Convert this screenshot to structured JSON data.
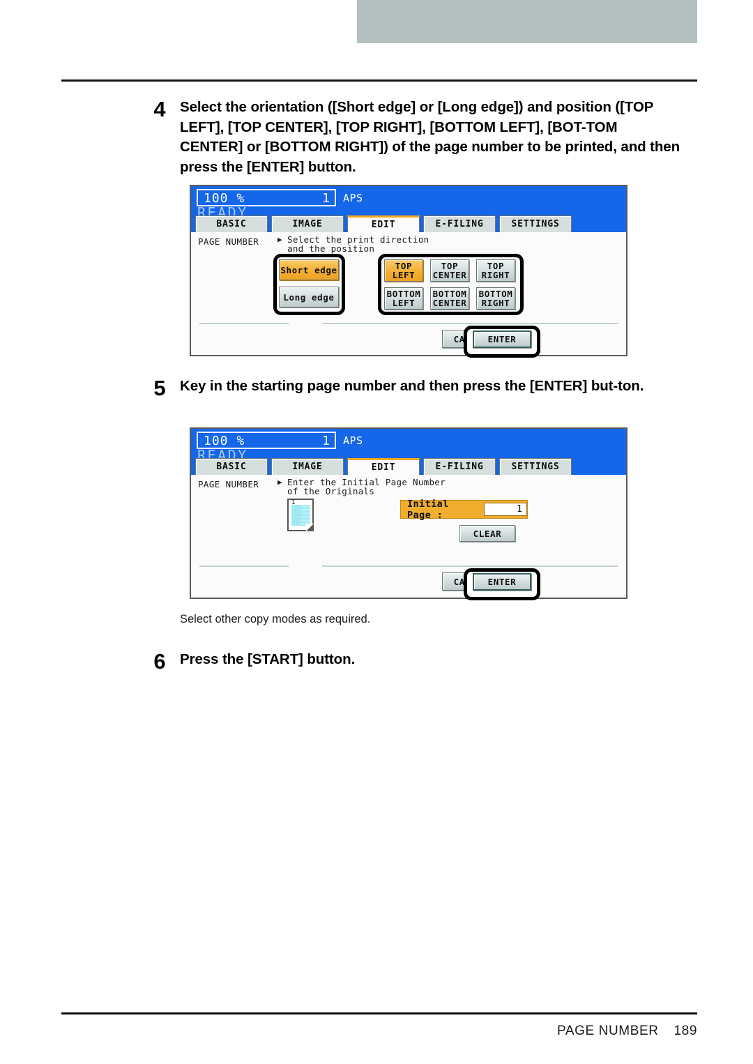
{
  "footer": {
    "label": "PAGE NUMBER",
    "page": "189"
  },
  "steps": [
    {
      "number": "4",
      "text": "Select the orientation ([Short edge] or [Long edge]) and position ([TOP LEFT], [TOP CENTER], [TOP RIGHT], [BOTTOM LEFT], [BOT-TOM CENTER] or [BOTTOM RIGHT]) of the page number to be printed, and then press the [ENTER] button."
    },
    {
      "number": "5",
      "text": "Key in the starting page number and then press the [ENTER] but-ton."
    },
    {
      "number": "6",
      "text": "Press the [START] button."
    }
  ],
  "note": "Select other copy modes as required.",
  "panel1": {
    "header": {
      "zoom": "100  %",
      "copies": "1",
      "paper_mode": "APS",
      "status": "READY"
    },
    "tabs": [
      {
        "label": "BASIC",
        "active": false
      },
      {
        "label": "IMAGE",
        "active": false
      },
      {
        "label": "EDIT",
        "active": true
      },
      {
        "label": "E-FILING",
        "active": false
      },
      {
        "label": "SETTINGS",
        "active": false
      }
    ],
    "function_label": "PAGE NUMBER",
    "instruction_line1": "Select the print direction",
    "instruction_line2": "and the position",
    "orientation_buttons": [
      {
        "label": "Short edge",
        "selected": true
      },
      {
        "label": "Long edge",
        "selected": false
      }
    ],
    "position_buttons": [
      {
        "line1": "TOP",
        "line2": "LEFT",
        "selected": true
      },
      {
        "line1": "TOP",
        "line2": "CENTER",
        "selected": false
      },
      {
        "line1": "TOP",
        "line2": "RIGHT",
        "selected": false
      },
      {
        "line1": "BOTTOM",
        "line2": "LEFT",
        "selected": false
      },
      {
        "line1": "BOTTOM",
        "line2": "CENTER",
        "selected": false
      },
      {
        "line1": "BOTTOM",
        "line2": "RIGHT",
        "selected": false
      }
    ],
    "cancel_label": "CANCEL",
    "enter_label": "ENTER"
  },
  "panel2": {
    "header": {
      "zoom": "100  %",
      "copies": "1",
      "paper_mode": "APS",
      "status": "READY"
    },
    "tabs": [
      {
        "label": "BASIC",
        "active": false
      },
      {
        "label": "IMAGE",
        "active": false
      },
      {
        "label": "EDIT",
        "active": true
      },
      {
        "label": "E-FILING",
        "active": false
      },
      {
        "label": "SETTINGS",
        "active": false
      }
    ],
    "function_label": "PAGE NUMBER",
    "instruction_line1": "Enter the Initial Page Number",
    "instruction_line2": "of the Originals",
    "thumbnail_number": "1",
    "initial_page_label": "Initial Page :",
    "initial_page_value": "1",
    "clear_label": "CLEAR",
    "cancel_label": "CANCEL",
    "enter_label": "ENTER"
  },
  "colors": {
    "lcd_blue": "#1566e8",
    "accent_orange": "#f0ad2e",
    "tab_active_border": "#f0a81e",
    "header_gray": "#b4bfbf"
  }
}
